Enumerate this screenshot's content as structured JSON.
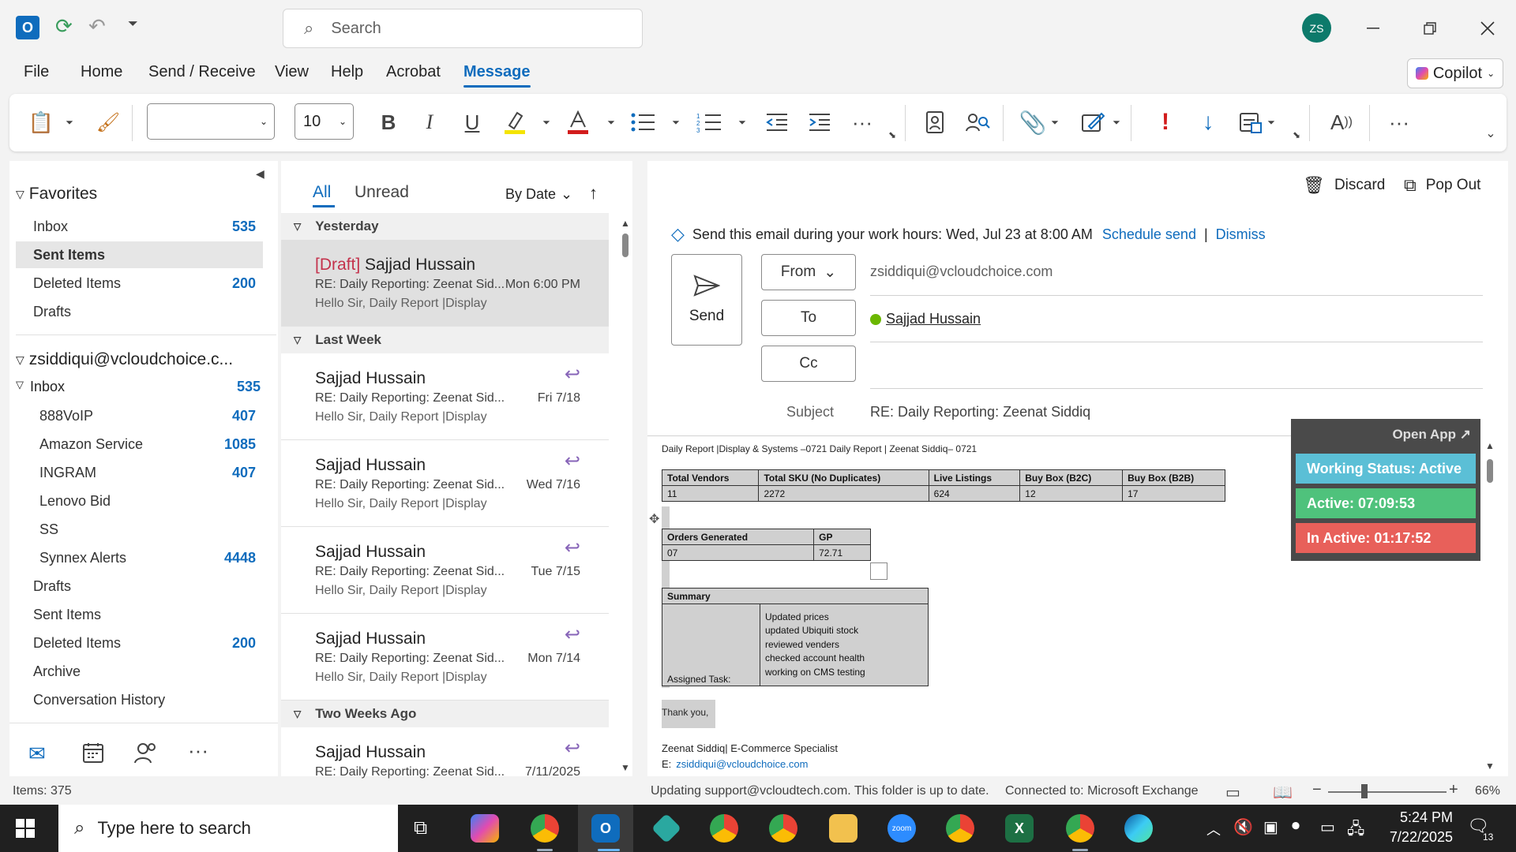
{
  "titlebar": {
    "search_placeholder": "Search",
    "avatar_initials": "ZS"
  },
  "menu": [
    "File",
    "Home",
    "Send / Receive",
    "View",
    "Help",
    "Acrobat",
    "Message"
  ],
  "copilot_label": "Copilot",
  "ribbon": {
    "font_size": "10"
  },
  "folders": {
    "favorites_label": "Favorites",
    "favorites": [
      {
        "name": "Inbox",
        "count": "535"
      },
      {
        "name": "Sent Items",
        "count": ""
      },
      {
        "name": "Deleted Items",
        "count": "200"
      },
      {
        "name": "Drafts",
        "count": ""
      }
    ],
    "account_label": "zsiddiqui@vcloudchoice.c...",
    "inbox_label": "Inbox",
    "inbox_count": "535",
    "subfolders": [
      {
        "name": "888VoIP",
        "count": "407"
      },
      {
        "name": "Amazon Service",
        "count": "1085"
      },
      {
        "name": "INGRAM",
        "count": "407"
      },
      {
        "name": "Lenovo Bid",
        "count": ""
      },
      {
        "name": "SS",
        "count": ""
      },
      {
        "name": "Synnex Alerts",
        "count": "4448"
      }
    ],
    "account_folders": [
      {
        "name": "Drafts",
        "count": ""
      },
      {
        "name": "Sent Items",
        "count": ""
      },
      {
        "name": "Deleted Items",
        "count": "200"
      },
      {
        "name": "Archive",
        "count": ""
      },
      {
        "name": "Conversation History",
        "count": ""
      }
    ]
  },
  "list": {
    "tab_all": "All",
    "tab_unread": "Unread",
    "sort": "By Date",
    "groups": [
      "Yesterday",
      "Last Week",
      "Two Weeks Ago"
    ],
    "messages": [
      {
        "draft": "[Draft]",
        "from": "Sajjad Hussain",
        "subject": "RE: Daily Reporting: Zeenat Sid...",
        "preview": "Hello Sir,  Daily Report |Display",
        "date": "Mon 6:00 PM"
      },
      {
        "from": "Sajjad Hussain",
        "subject": "RE: Daily Reporting: Zeenat Sid...",
        "preview": "Hello Sir,  Daily Report |Display",
        "date": "Fri 7/18"
      },
      {
        "from": "Sajjad Hussain",
        "subject": "RE: Daily Reporting: Zeenat Sid...",
        "preview": "Hello Sir,  Daily Report |Display",
        "date": "Wed 7/16"
      },
      {
        "from": "Sajjad Hussain",
        "subject": "RE: Daily Reporting: Zeenat Sid...",
        "preview": "Hello Sir,  Daily Report |Display",
        "date": "Tue 7/15"
      },
      {
        "from": "Sajjad Hussain",
        "subject": "RE: Daily Reporting: Zeenat Sid...",
        "preview": "Hello Sir,  Daily Report |Display",
        "date": "Mon 7/14"
      },
      {
        "from": "Sajjad Hussain",
        "subject": "RE: Daily Reporting: Zeenat Sid...",
        "preview": "",
        "date": "7/11/2025"
      }
    ]
  },
  "compose": {
    "discard": "Discard",
    "popout": "Pop Out",
    "banner_text": "Send this email during your work hours: Wed, Jul 23 at 8:00 AM",
    "schedule_send": "Schedule send",
    "separator": "|",
    "dismiss": "Dismiss",
    "send": "Send",
    "from_btn": "From",
    "to_btn": "To",
    "cc_btn": "Cc",
    "from_value": "zsiddiqui@vcloudchoice.com",
    "to_value": "Sajjad Hussain",
    "subject_label": "Subject",
    "subject_value": "RE: Daily Reporting: Zeenat Siddiq"
  },
  "body": {
    "heading": "Daily Report |Display & Systems –0721 Daily Report | Zeenat Siddiq– 0721",
    "t1_headers": [
      "Total Vendors",
      "Total SKU (No Duplicates)",
      "Live Listings",
      "Buy Box (B2C)",
      "Buy Box (B2B)"
    ],
    "t1_values": [
      "11",
      "2272",
      "624",
      "12",
      "17"
    ],
    "t2_headers": [
      "Orders Generated",
      "GP"
    ],
    "t2_values": [
      "07",
      "72.71"
    ],
    "summary_label": "Summary",
    "assigned_label": "Assigned Task:",
    "summary_items": [
      "Updated prices",
      "updated Ubiquiti stock",
      "reviewed venders",
      "checked account health",
      "working on CMS testing"
    ],
    "thanks": "Thank you,",
    "sig_name": "Zeenat Siddiq| E-Commerce Specialist",
    "sig_email_label": "E:",
    "sig_email": "zsiddiqui@vcloudchoice.com"
  },
  "widget": {
    "open_app": "Open App ↗",
    "status": "Working Status: Active",
    "active": "Active: 07:09:53",
    "inactive": "In Active: 01:17:52",
    "colors": {
      "status": "#5bbfd6",
      "active": "#4fc27c",
      "inactive": "#e8605a"
    }
  },
  "statusbar": {
    "items": "Items: 375",
    "updating": "Updating support@vcloudtech.com.  This folder is up to date.",
    "connected": "Connected to: Microsoft Exchange",
    "zoom": "66%"
  },
  "taskbar": {
    "search_placeholder": "Type here to search",
    "time": "5:24 PM",
    "date": "7/22/2025",
    "notif": "13"
  }
}
